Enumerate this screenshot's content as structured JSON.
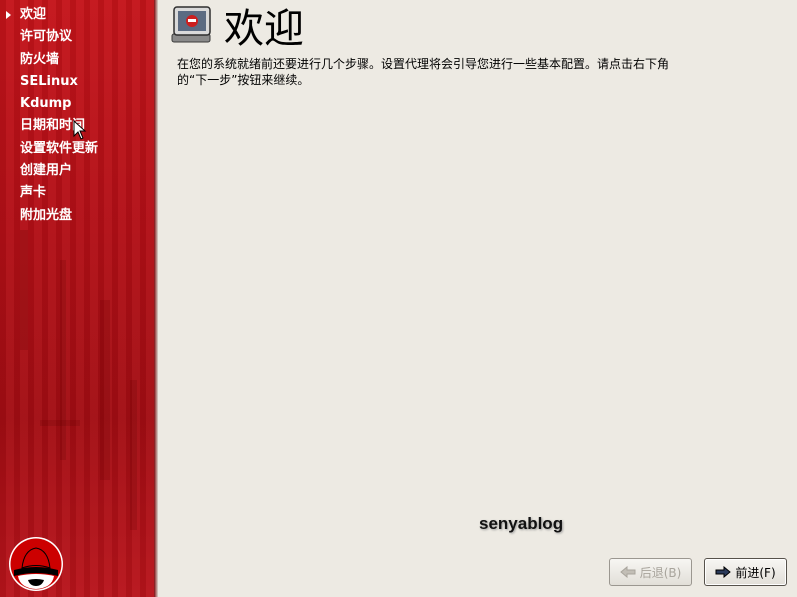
{
  "sidebar": {
    "current_index": 0,
    "items": [
      {
        "label": "欢迎"
      },
      {
        "label": "许可协议"
      },
      {
        "label": "防火墙"
      },
      {
        "label": "SELinux"
      },
      {
        "label": "Kdump"
      },
      {
        "label": "日期和时间"
      },
      {
        "label": "设置软件更新"
      },
      {
        "label": "创建用户"
      },
      {
        "label": "声卡"
      },
      {
        "label": "附加光盘"
      }
    ]
  },
  "main": {
    "title": "欢迎",
    "description": "在您的系统就绪前还要进行几个步骤。设置代理将会引导您进行一些基本配置。请点击右下角的“下一步”按钮来继续。"
  },
  "watermark": "senyablog",
  "buttons": {
    "back_label": "后退(B)",
    "next_label": "前进(F)"
  },
  "icons": {
    "header": "computer-monitor-icon",
    "back": "arrow-left-icon",
    "next": "arrow-right-icon",
    "logo": "redhat-shadowman-logo"
  },
  "colors": {
    "sidebar_red": "#b10f16",
    "background": "#edeae3",
    "disabled_text": "#a8a49c"
  }
}
